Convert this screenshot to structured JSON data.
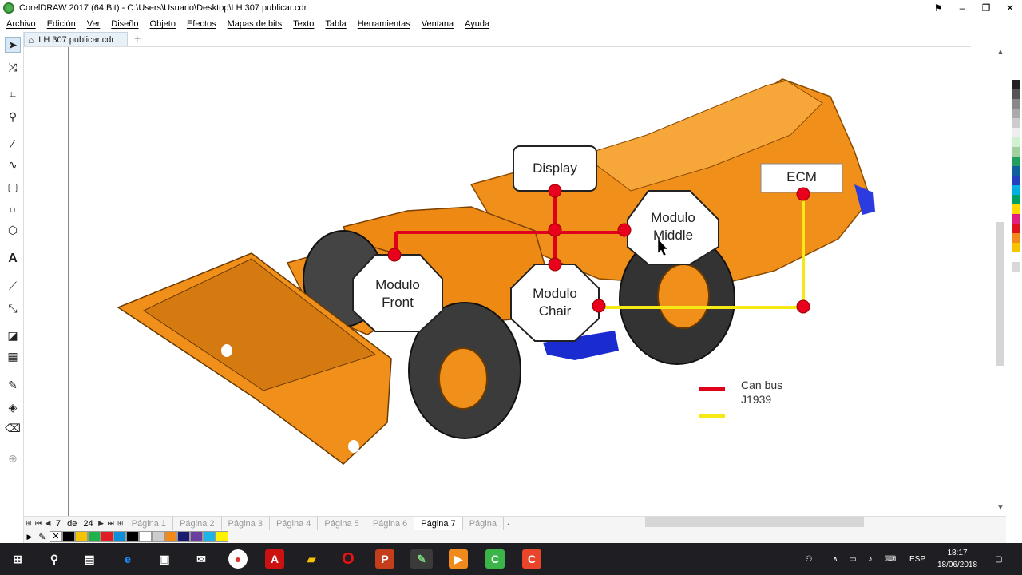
{
  "window": {
    "title": "CorelDRAW 2017 (64 Bit) - C:\\Users\\Usuario\\Desktop\\LH 307 publicar.cdr"
  },
  "menu": [
    "Archivo",
    "Edición",
    "Ver",
    "Diseño",
    "Objeto",
    "Efectos",
    "Mapas de bits",
    "Texto",
    "Tabla",
    "Herramientas",
    "Ventana",
    "Ayuda"
  ],
  "document_tab": {
    "label": "LH 307 publicar.cdr"
  },
  "diagram": {
    "nodes": {
      "display": "Display",
      "ecm": "ECM",
      "middle_line1": "Modulo",
      "middle_line2": "Middle",
      "front_line1": "Modulo",
      "front_line2": "Front",
      "chair_line1": "Modulo",
      "chair_line2": "Chair"
    },
    "legend": {
      "can_line1": "Can bus",
      "can_line2": "J1939"
    },
    "colors": {
      "can_bus": "#e0001b",
      "j1939": "#f5ea14",
      "machine": "#f0901a",
      "wheel": "#3b3b3b",
      "node_dot": "#e8001c"
    }
  },
  "page_nav": {
    "current": "7",
    "of_label": "de",
    "total": "24",
    "tabs": [
      "Página 1",
      "Página 2",
      "Página 3",
      "Página 4",
      "Página 5",
      "Página 6",
      "Página 7",
      "Página"
    ],
    "active_index": 6
  },
  "palette_colors": [
    "#000000",
    "#f5c400",
    "#20b24a",
    "#e01e26",
    "#0a8fd8",
    "#000000",
    "#ffffff",
    "#cccccc",
    "#f08a1c",
    "#1a1a6e",
    "#6a3fa0",
    "#1fb4e8",
    "#fff200"
  ],
  "right_palette_colors": [
    "#222222",
    "#555555",
    "#888888",
    "#aaaaaa",
    "#cccccc",
    "#eeeeee",
    "#d0f0d0",
    "#a0d0a0",
    "#20a060",
    "#1060a0",
    "#2040c0",
    "#00b0e0",
    "#00a060",
    "#ffd800",
    "#e02080",
    "#e01020",
    "#f08a1c",
    "#f5c400",
    "#ffffff",
    "#d8d8d8"
  ],
  "taskbar": {
    "time": "18:17",
    "date": "18/06/2018",
    "lang": "ESP"
  }
}
